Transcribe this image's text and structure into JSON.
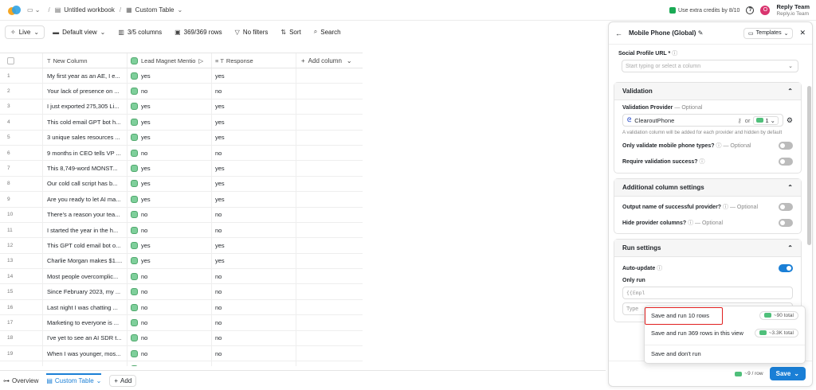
{
  "topbar": {
    "workbook": "Untitled workbook",
    "table": "Custom Table",
    "credits": "Use extra credits by 8/10",
    "account_initial": "O",
    "account_name": "Reply Team",
    "account_sub": "Reply.io Team"
  },
  "toolbar": {
    "live": "Live",
    "view": "Default view",
    "columns": "3/5 columns",
    "rows": "369/369 rows",
    "filters": "No filters",
    "sort": "Sort",
    "search": "Search"
  },
  "grid": {
    "headers": [
      "New Column",
      "Lead Magnet Mentio",
      "Response",
      "Add column"
    ],
    "rows": [
      [
        "My first year as an AE, I e...",
        "yes",
        "yes"
      ],
      [
        "Your lack of presence on ...",
        "no",
        "no"
      ],
      [
        "I just exported 275,305 Li...",
        "yes",
        "yes"
      ],
      [
        "This cold email GPT bot h...",
        "yes",
        "yes"
      ],
      [
        "3 unique sales resources ...",
        "yes",
        "yes"
      ],
      [
        "9 months in CEO tells VP ...",
        "no",
        "no"
      ],
      [
        "This 8,749-word MONST...",
        "yes",
        "yes"
      ],
      [
        "Our cold call script has b...",
        "yes",
        "yes"
      ],
      [
        "Are you ready to let AI ma...",
        "yes",
        "yes"
      ],
      [
        "There's a reason your tea...",
        "no",
        "no"
      ],
      [
        "I started the year in the h...",
        "no",
        "no"
      ],
      [
        "This GPT cold email bot o...",
        "yes",
        "yes"
      ],
      [
        "Charlie Morgan makes $1....",
        "yes",
        "yes"
      ],
      [
        "Most people overcomplic...",
        "no",
        "no"
      ],
      [
        "Since February 2023, my ...",
        "no",
        "no"
      ],
      [
        "Last night I was chatting ...",
        "no",
        "no"
      ],
      [
        "Marketing to everyone is ...",
        "no",
        "no"
      ],
      [
        "I've yet to see an AI SDR t...",
        "no",
        "no"
      ],
      [
        "When I was younger, mos...",
        "no",
        "no"
      ],
      [
        "\"The days are shorter... a...",
        "no",
        "no"
      ]
    ]
  },
  "bottom": {
    "overview": "Overview",
    "custom": "Custom Table",
    "add": "Add"
  },
  "panel": {
    "title": "Mobile Phone (Global)",
    "templates": "Templates",
    "social_label": "Social Profile URL *",
    "social_placeholder": "Start typing or select a column",
    "validation": {
      "title": "Validation",
      "provider_label": "Validation Provider",
      "provider_opt": "— Optional",
      "provider": "ClearoutPhone",
      "or": "or",
      "count": "1",
      "note": "A validation column will be added for each provider and hidden by default",
      "only_mobile": "Only validate mobile phone types?",
      "only_mobile_opt": "— Optional",
      "require": "Require validation success?"
    },
    "additional": {
      "title": "Additional column settings",
      "output": "Output name of successful provider?",
      "output_opt": "— Optional",
      "hide": "Hide provider columns?",
      "hide_opt": "— Optional"
    },
    "run": {
      "title": "Run settings",
      "auto": "Auto-update",
      "only_run": "Only run",
      "input_ph": "{{Empl",
      "type": "Type"
    },
    "footer": {
      "cost": "~9 / row",
      "save": "Save"
    }
  },
  "dropdown": {
    "items": [
      {
        "label": "Save and run 10 rows",
        "badge": "~90 total"
      },
      {
        "label": "Save and run 369 rows in this view",
        "badge": "~3.3K total"
      },
      {
        "label": "Save and don't run",
        "badge": ""
      }
    ]
  }
}
